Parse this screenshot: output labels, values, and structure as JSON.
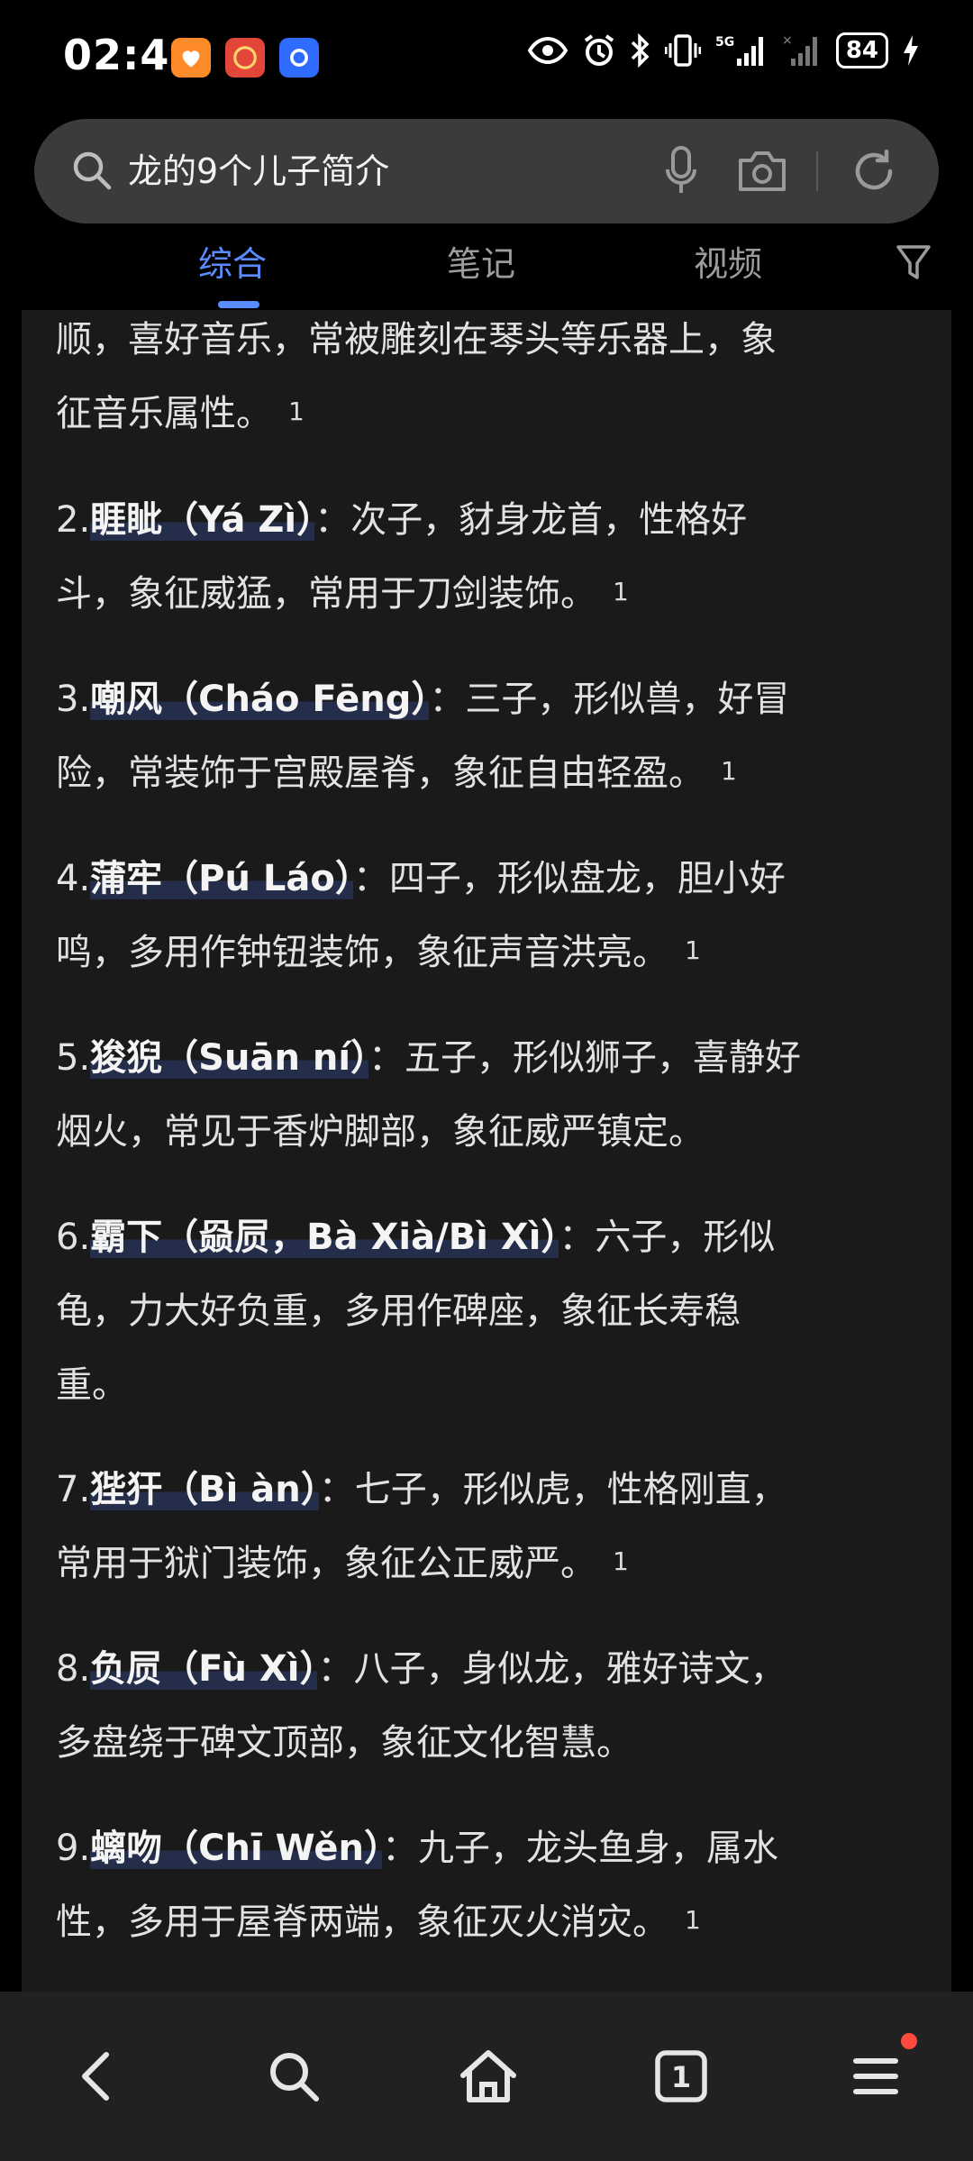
{
  "status_bar": {
    "time": "02:49",
    "battery": "84",
    "icons": [
      "eye-icon",
      "alarm-icon",
      "bluetooth-icon",
      "vibrate-icon",
      "signal-5g-icon",
      "signal-icon",
      "lightning-icon"
    ]
  },
  "search": {
    "query": "龙的9个儿子简介"
  },
  "tabs": [
    {
      "label": "综合",
      "active": true
    },
    {
      "label": "笔记",
      "active": false
    },
    {
      "label": "视频",
      "active": false
    }
  ],
  "content": {
    "intro_line1": "顺，喜好音乐，常被雕刻在琴头等乐器上，象",
    "intro_line2": "征音乐属性。",
    "intro_ref": "1",
    "items": [
      {
        "num": "2.",
        "name": "睚眦（Yá Zì）",
        "colon": "：",
        "line1": "次子，豺身龙首，性格好",
        "line2": "斗，象征威猛，常用于刀剑装饰。",
        "ref": "1"
      },
      {
        "num": "3.",
        "name": "嘲风（Cháo Fēng）",
        "colon": "：",
        "line1": "三子，形似兽，好冒",
        "line2": "险，常装饰于宫殿屋脊，象征自由轻盈。",
        "ref": "1"
      },
      {
        "num": "4.",
        "name": "蒲牢（Pú Láo）",
        "colon": "：",
        "line1": "四子，形似盘龙，胆小好",
        "line2": "鸣，多用作钟钮装饰，象征声音洪亮。",
        "ref": "1"
      },
      {
        "num": "5.",
        "name": "狻猊（Suān ní）",
        "colon": "：",
        "line1": "五子，形似狮子，喜静好",
        "line2": "烟火，常见于香炉脚部，象征威严镇定。",
        "ref": ""
      },
      {
        "num": "6.",
        "name": "霸下（赑屃，Bà Xià/Bì Xì）",
        "colon": "：",
        "line1": "六子，形似",
        "line2": "龟，力大好负重，多用作碑座，象征长寿稳",
        "line3": "重。",
        "ref": ""
      },
      {
        "num": "7.",
        "name": "狴犴（Bì àn）",
        "colon": "：",
        "line1": "七子，形似虎，性格刚直，",
        "line2": "常用于狱门装饰，象征公正威严。",
        "ref": "1"
      },
      {
        "num": "8.",
        "name": "负屃（Fù Xì）",
        "colon": "：",
        "line1": "八子，身似龙，雅好诗文，",
        "line2": "多盘绕于碑文顶部，象征文化智慧。",
        "ref": ""
      },
      {
        "num": "9.",
        "name": "螭吻（Chī Wěn）",
        "colon": "：",
        "line1": "九子，龙头鱼身，属水",
        "line2": "性，多用于屋脊两端，象征灭火消灾。",
        "ref": "1"
      }
    ]
  },
  "bottom_nav": {
    "tab_count": "1"
  }
}
